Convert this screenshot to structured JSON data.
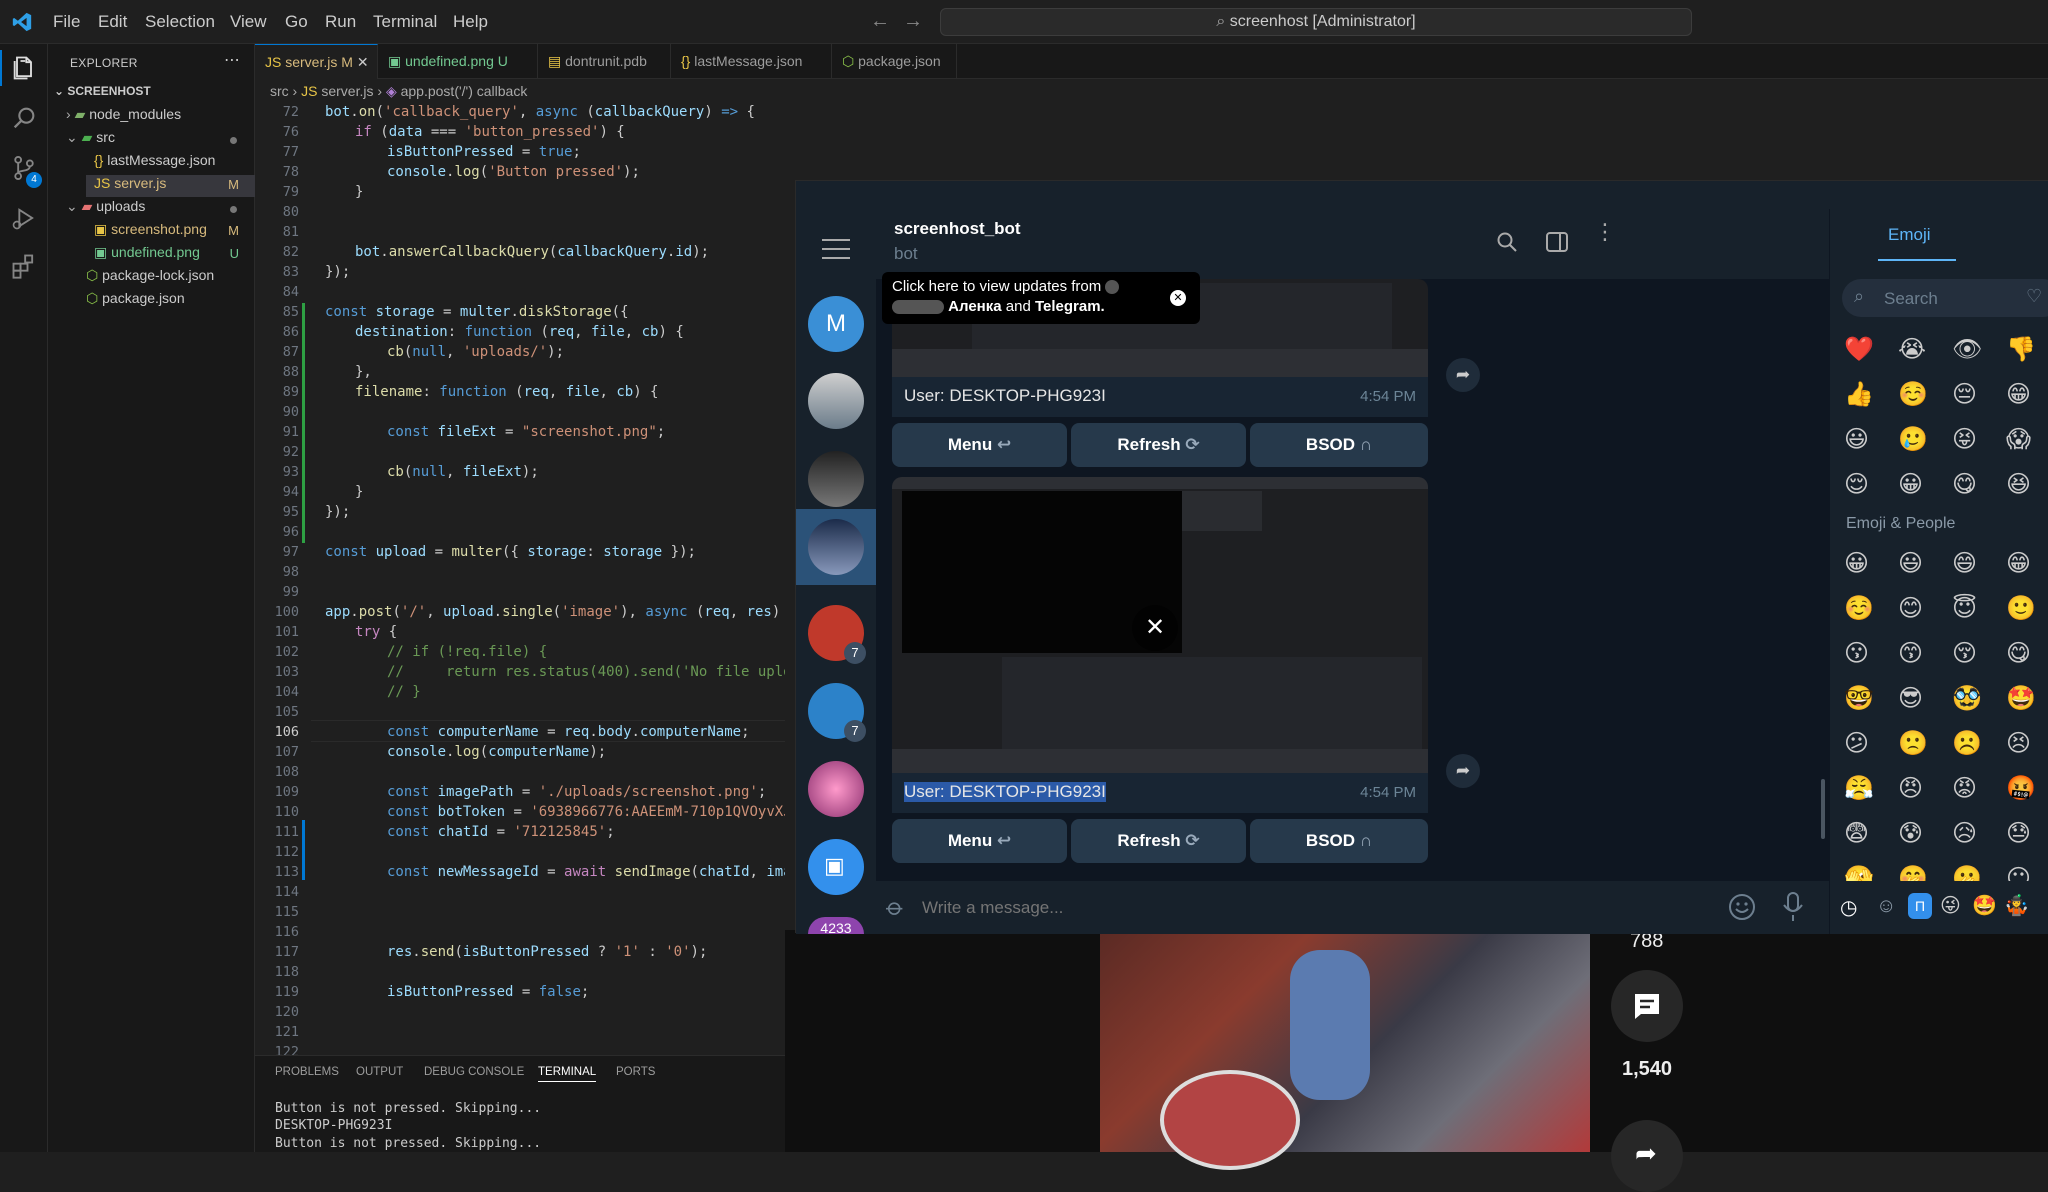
{
  "titlebar": {
    "menu": [
      "File",
      "Edit",
      "Selection",
      "View",
      "Go",
      "Run",
      "Terminal",
      "Help"
    ],
    "search": "screenhost [Administrator]"
  },
  "activity": {
    "scm_badge": "4"
  },
  "sidebar": {
    "header": "EXPLORER",
    "root": "SCREENHOST",
    "items": [
      {
        "label": "node_modules"
      },
      {
        "label": "src"
      },
      {
        "label": "lastMessage.json"
      },
      {
        "label": "server.js",
        "badge": "M"
      },
      {
        "label": "uploads"
      },
      {
        "label": "screenshot.png",
        "badge": "M"
      },
      {
        "label": "undefined.png",
        "badge": "U"
      },
      {
        "label": "package-lock.json"
      },
      {
        "label": "package.json"
      }
    ]
  },
  "tabs": [
    {
      "label": "server.js",
      "badge": "M"
    },
    {
      "label": "undefined.png",
      "badge": "U"
    },
    {
      "label": "dontrunit.pdb"
    },
    {
      "label": "lastMessage.json"
    },
    {
      "label": "package.json"
    }
  ],
  "breadcrumb": {
    "a": "src",
    "b": "server.js",
    "c": "app.post('/') callback"
  },
  "editor": {
    "lines": [
      "72",
      "76",
      "77",
      "78",
      "79",
      "80",
      "81",
      "82",
      "83",
      "84",
      "85",
      "86",
      "87",
      "88",
      "89",
      "90",
      "91",
      "92",
      "93",
      "94",
      "95",
      "96",
      "97",
      "98",
      "99",
      "100",
      "101",
      "102",
      "103",
      "104",
      "105",
      "106",
      "107",
      "108",
      "109",
      "110",
      "111",
      "112",
      "113",
      "114",
      "115",
      "116",
      "117",
      "118",
      "119",
      "120",
      "121",
      "122"
    ]
  },
  "panel": {
    "tabs": [
      "PROBLEMS",
      "OUTPUT",
      "DEBUG CONSOLE",
      "TERMINAL",
      "PORTS"
    ],
    "lines": [
      "Button is not pressed. Skipping...",
      "DESKTOP-PHG923I",
      "Button is not pressed. Skipping..."
    ]
  },
  "telegram": {
    "chat_name": "screenhost_bot",
    "chat_sub": "bot",
    "tooltip_a": "Click here to view updates from",
    "tooltip_b": "Аленка",
    "tooltip_c": "and",
    "tooltip_d": "Telegram.",
    "messages": [
      {
        "caption": "User: DESKTOP-PHG923I",
        "time": "4:54 PM"
      },
      {
        "caption": "User: DESKTOP-PHG923I",
        "time": "4:54 PM"
      }
    ],
    "keyboard": [
      "Menu",
      "Refresh",
      "BSOD"
    ],
    "compose_placeholder": "Write a message...",
    "unread": [
      "7",
      "7"
    ],
    "last_avatar_text": "4233",
    "avatar_letter": "M",
    "emoji_tab": "Emoji",
    "emoji_search": "Search",
    "emoji_section": "Emoji & People",
    "emoji_row1": [
      "❤️",
      "😭",
      "👁",
      "👎"
    ],
    "emoji_row2": [
      "👍",
      "☺️",
      "😔",
      "😁"
    ],
    "emoji_row3": [
      "😃",
      "🥲",
      "😝",
      "😱"
    ],
    "emoji_row4": [
      "😌",
      "😀",
      "😋",
      "😆"
    ],
    "emoji_people": [
      "😀",
      "😃",
      "😄",
      "😁",
      "☺️",
      "😊",
      "😇",
      "🙂",
      "😗",
      "😙",
      "😚",
      "😋",
      "🤓",
      "😎",
      "🥸",
      "🤩",
      "😕",
      "🙁",
      "☹️",
      "😣",
      "😤",
      "😠",
      "😡",
      "🤬",
      "😨",
      "😰",
      "😥",
      "😓",
      "🫣",
      "🤭",
      "🫢",
      "😶"
    ]
  },
  "video": {
    "likes": "788",
    "comments": "1,540"
  }
}
